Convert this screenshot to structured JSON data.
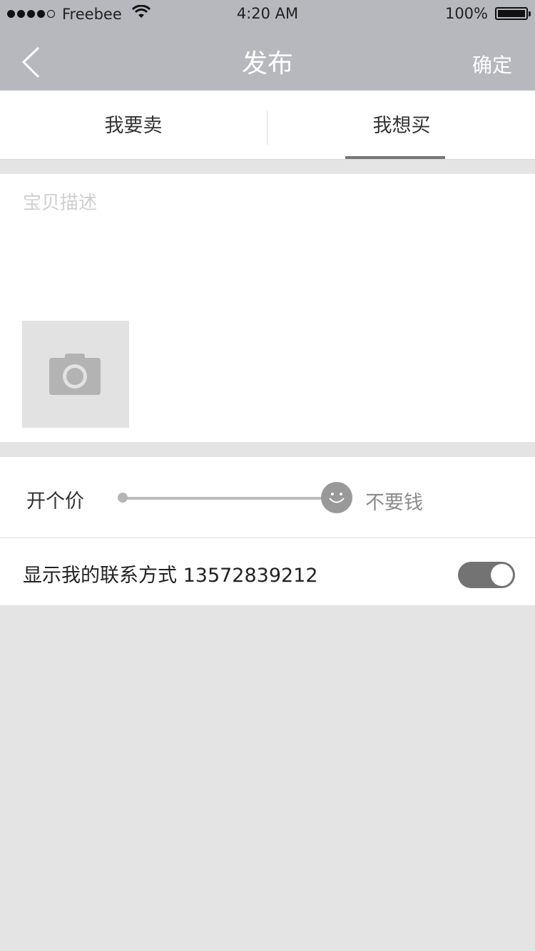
{
  "status_bar": {
    "carrier": "Freebee",
    "time": "4:20 AM",
    "battery": "100%"
  },
  "nav": {
    "title": "发布",
    "confirm_label": "确定"
  },
  "tabs": [
    {
      "label": "我要卖",
      "selected": false
    },
    {
      "label": "我想买",
      "selected": true
    }
  ],
  "description": {
    "placeholder": "宝贝描述",
    "value": ""
  },
  "price": {
    "label": "开个价",
    "value": "不要钱"
  },
  "contact": {
    "label": "显示我的联系方式 13572839212",
    "enabled": true
  },
  "icons": {
    "back": "back-chevron-icon",
    "camera": "camera-icon",
    "slider_knob": "smiley-icon",
    "wifi": "wifi-icon",
    "battery": "battery-icon"
  },
  "colors": {
    "nav_background": "#b7b7be",
    "page_background": "#e4e4e4",
    "toggle_on": "#737373"
  }
}
